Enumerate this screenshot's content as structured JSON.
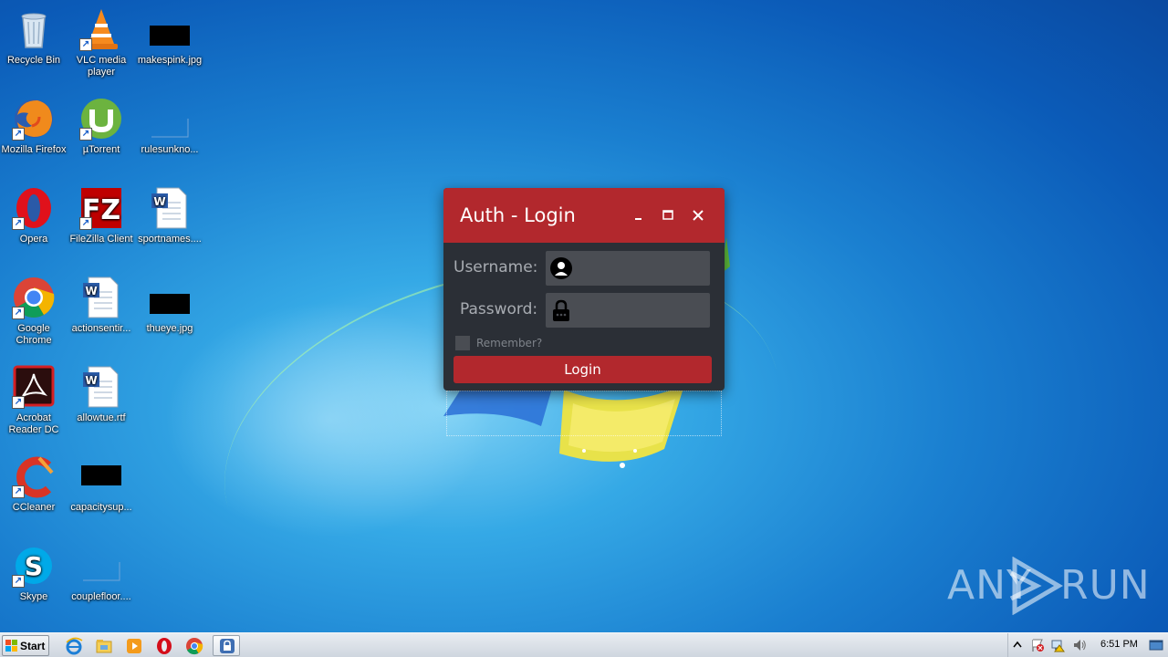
{
  "desktop": {
    "icons": [
      {
        "label": "Recycle Bin"
      },
      {
        "label": "VLC media player"
      },
      {
        "label": "makespink.jpg"
      },
      {
        "label": "Mozilla Firefox"
      },
      {
        "label": "µTorrent"
      },
      {
        "label": "rulesunkno..."
      },
      {
        "label": "Opera"
      },
      {
        "label": "FileZilla Client"
      },
      {
        "label": "sportnames...."
      },
      {
        "label": "Google Chrome"
      },
      {
        "label": "actionsentir..."
      },
      {
        "label": "thueye.jpg"
      },
      {
        "label": "Acrobat Reader DC"
      },
      {
        "label": "allowtue.rtf"
      },
      {
        "label": "CCleaner"
      },
      {
        "label": "capacitysup..."
      },
      {
        "label": "Skype"
      },
      {
        "label": "couplefloor...."
      }
    ]
  },
  "dialog": {
    "title": "Auth - Login",
    "username_label": "Username:",
    "password_label": "Password:",
    "username_value": "",
    "password_value": "",
    "remember_label": "Remember?",
    "login_label": "Login",
    "accent": "#b2282d",
    "background": "#2b2f36"
  },
  "watermark": {
    "left": "ANY",
    "right": "RUN"
  },
  "taskbar": {
    "start_label": "Start",
    "clock": "6:51 PM"
  }
}
